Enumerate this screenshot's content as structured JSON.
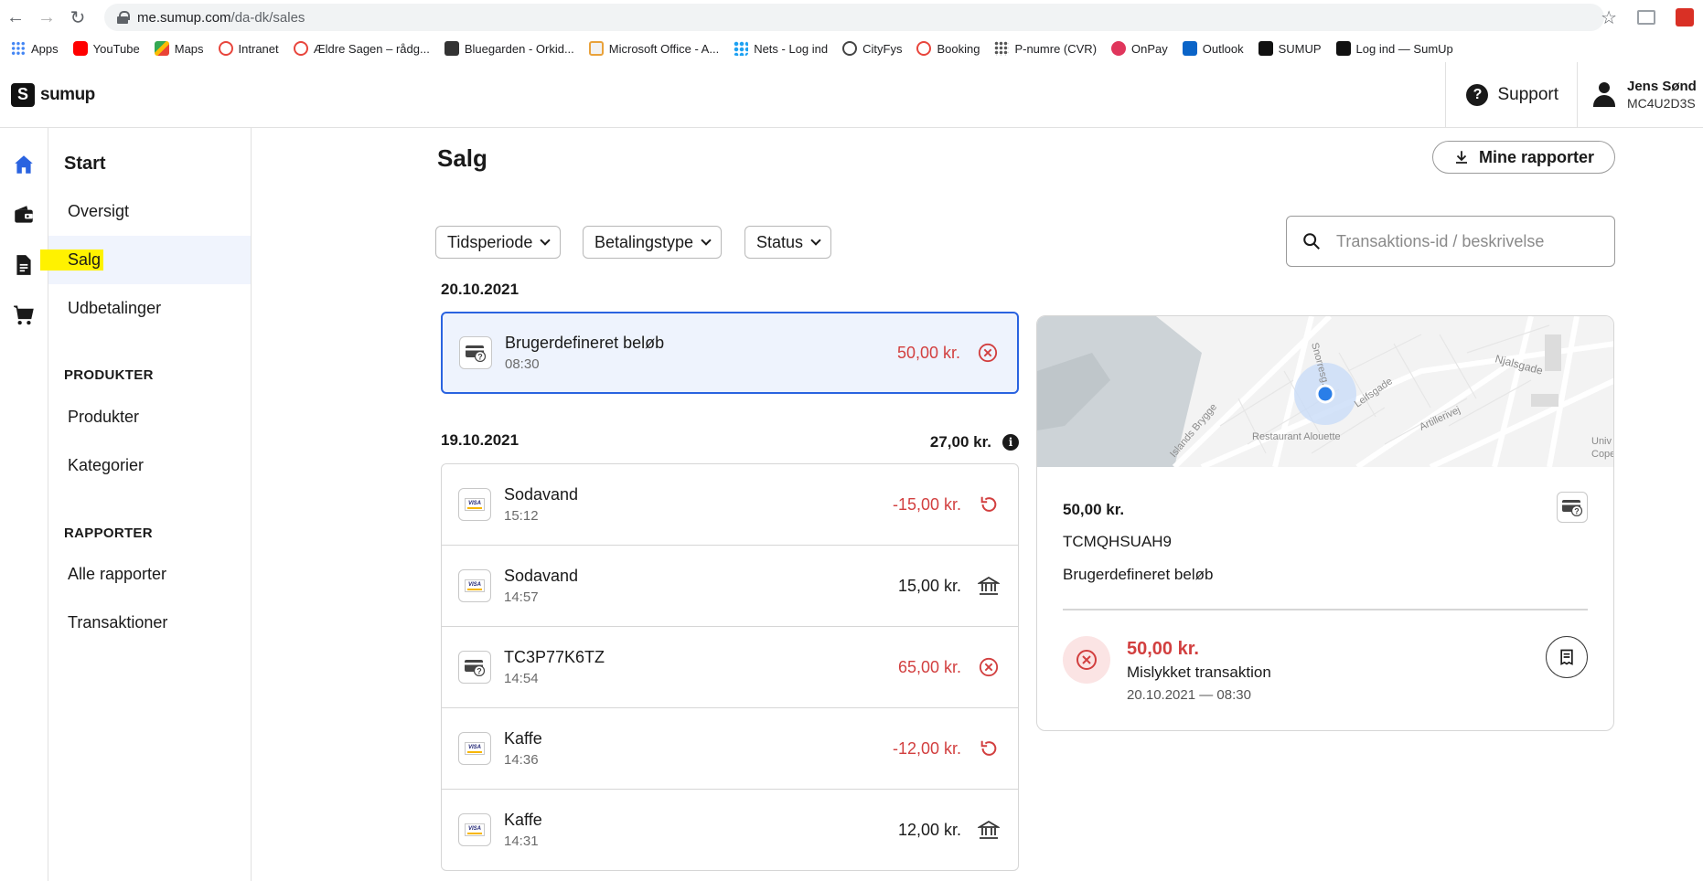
{
  "browser": {
    "url_host": "me.sumup.com",
    "url_path": "/da-dk/sales",
    "bookmarks": [
      {
        "label": "Apps",
        "icon": "apps-grid-icon"
      },
      {
        "label": "YouTube",
        "icon": "youtube-icon"
      },
      {
        "label": "Maps",
        "icon": "maps-icon"
      },
      {
        "label": "Intranet",
        "icon": "intranet-icon"
      },
      {
        "label": "Ældre Sagen – rådg...",
        "icon": "aeldre-sagen-icon"
      },
      {
        "label": "Bluegarden - Orkid...",
        "icon": "bluegarden-icon"
      },
      {
        "label": "Microsoft Office - A...",
        "icon": "microsoft-office-icon"
      },
      {
        "label": "Nets - Log ind",
        "icon": "nets-icon"
      },
      {
        "label": "CityFys",
        "icon": "globe-icon"
      },
      {
        "label": "Booking",
        "icon": "booking-icon"
      },
      {
        "label": "P-numre (CVR)",
        "icon": "cvr-icon"
      },
      {
        "label": "OnPay",
        "icon": "onpay-icon"
      },
      {
        "label": "Outlook",
        "icon": "outlook-icon"
      },
      {
        "label": "SUMUP",
        "icon": "sumup-icon"
      },
      {
        "label": "Log ind — SumUp",
        "icon": "sumup-icon"
      }
    ]
  },
  "header": {
    "logo_text": "sumup",
    "support_label": "Support",
    "user_name": "Jens Sønd",
    "user_id": "MC4U2D3S"
  },
  "nav": {
    "start_title": "Start",
    "items_start": [
      "Oversigt",
      "Salg",
      "Udbetalinger"
    ],
    "active_item": "Salg",
    "section_products": "PRODUKTER",
    "items_products": [
      "Produkter",
      "Kategorier"
    ],
    "section_reports": "RAPPORTER",
    "items_reports": [
      "Alle rapporter",
      "Transaktioner"
    ]
  },
  "main": {
    "title": "Salg",
    "reports_button": "Mine rapporter",
    "filters": [
      "Tidsperiode",
      "Betalingstype",
      "Status"
    ],
    "search_placeholder": "Transaktions-id / beskrivelse",
    "groups": [
      {
        "date": "20.10.2021",
        "total": "",
        "transactions": [
          {
            "title": "Brugerdefineret beløb",
            "time": "08:30",
            "amount": "50,00 kr.",
            "status": "failed",
            "method": "card-unknown",
            "selected": true
          }
        ]
      },
      {
        "date": "19.10.2021",
        "total": "27,00 kr.",
        "transactions": [
          {
            "title": "Sodavand",
            "time": "15:12",
            "amount": "-15,00 kr.",
            "status": "refunded",
            "method": "visa"
          },
          {
            "title": "Sodavand",
            "time": "14:57",
            "amount": "15,00 kr.",
            "status": "paid-out",
            "method": "visa"
          },
          {
            "title": "TC3P77K6TZ",
            "time": "14:54",
            "amount": "65,00 kr.",
            "status": "failed",
            "method": "card-unknown"
          },
          {
            "title": "Kaffe",
            "time": "14:36",
            "amount": "-12,00 kr.",
            "status": "refunded",
            "method": "visa"
          },
          {
            "title": "Kaffe",
            "time": "14:31",
            "amount": "12,00 kr.",
            "status": "paid-out",
            "method": "visa"
          }
        ]
      }
    ]
  },
  "detail": {
    "amount": "50,00 kr.",
    "transaction_code": "TCMQHSUAH9",
    "description": "Brugerdefineret beløb",
    "status_amount": "50,00 kr.",
    "status_label": "Mislykket transaktion",
    "status_datetime": "20.10.2021 — 08:30",
    "map_labels": [
      "Snorresg.",
      "Leifsgade",
      "Njalsgade",
      "Artillerivej",
      "Islands Brygge",
      "Restaurant Alouette",
      "Univ",
      "Cope"
    ]
  },
  "colors": {
    "accent": "#2a63e0",
    "negative": "#d23f3f",
    "selected_bg": "#eef3fd",
    "highlight": "#fff200"
  }
}
